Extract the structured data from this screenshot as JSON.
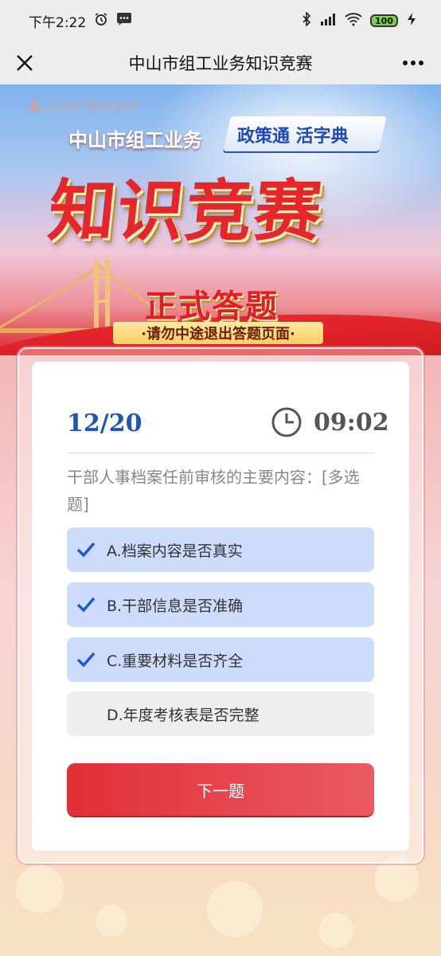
{
  "status_bar": {
    "time": "下午2:22",
    "battery": "100"
  },
  "nav": {
    "title": "中山市组工业务知识竞赛"
  },
  "banner": {
    "phone": "13427039669",
    "subtitle": "中山市组工业务",
    "ribbon": "政策通 活字典",
    "main_title": "知识竞赛",
    "exam_title": "正式答题",
    "warning": "·请勿中途退出答题页面·"
  },
  "quiz": {
    "progress": "12/20",
    "timer": "09:02",
    "question": "干部人事档案任前审核的主要内容：[多选题]",
    "options": [
      {
        "label": "A.档案内容是否真实",
        "selected": true
      },
      {
        "label": "B.干部信息是否准确",
        "selected": true
      },
      {
        "label": "C.重要材料是否齐全",
        "selected": true
      },
      {
        "label": "D.年度考核表是否完整",
        "selected": false
      }
    ],
    "next_label": "下一题"
  },
  "colors": {
    "accent_blue": "#1d57b6",
    "selected_bg": "#cddcfa",
    "button_red": "#e22f36"
  }
}
